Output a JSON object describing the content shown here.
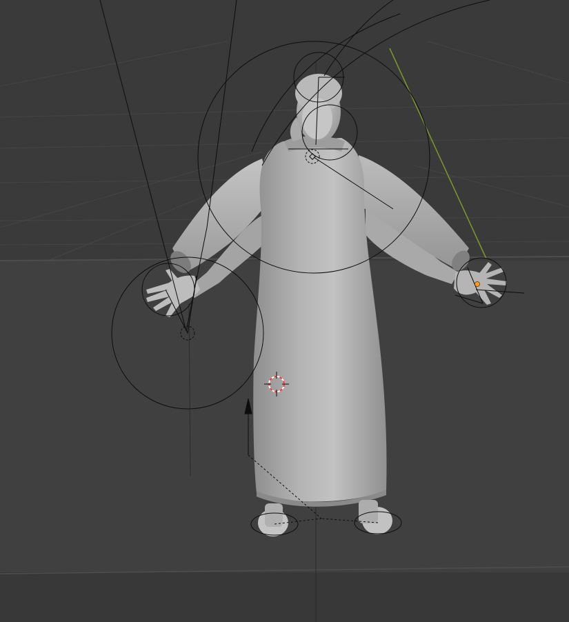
{
  "viewport": {
    "background_color": "#3a3a3a",
    "floor_color": "#404040",
    "grid_line_color": "#454545",
    "floor_line_color": "#4e4e4e",
    "wire_color": "#0d0d0d",
    "mesh_base_color": "#a6a6a6",
    "mesh_light_color": "#c9c9c9",
    "axis_y_color": "#7a9a2a",
    "active_handle_color": "#ff9f1a",
    "cursor_color_a": "#ff3030",
    "cursor_color_b": "#ffffff"
  },
  "scene": {
    "character": "robed-figure-mesh",
    "armature": "armature-rig",
    "objects": [
      {
        "name": "robed-figure-mesh",
        "icon": "mesh-icon"
      },
      {
        "name": "armature-rig",
        "icon": "armature-icon"
      },
      {
        "name": "3d-cursor",
        "icon": "cursor-icon"
      }
    ]
  }
}
